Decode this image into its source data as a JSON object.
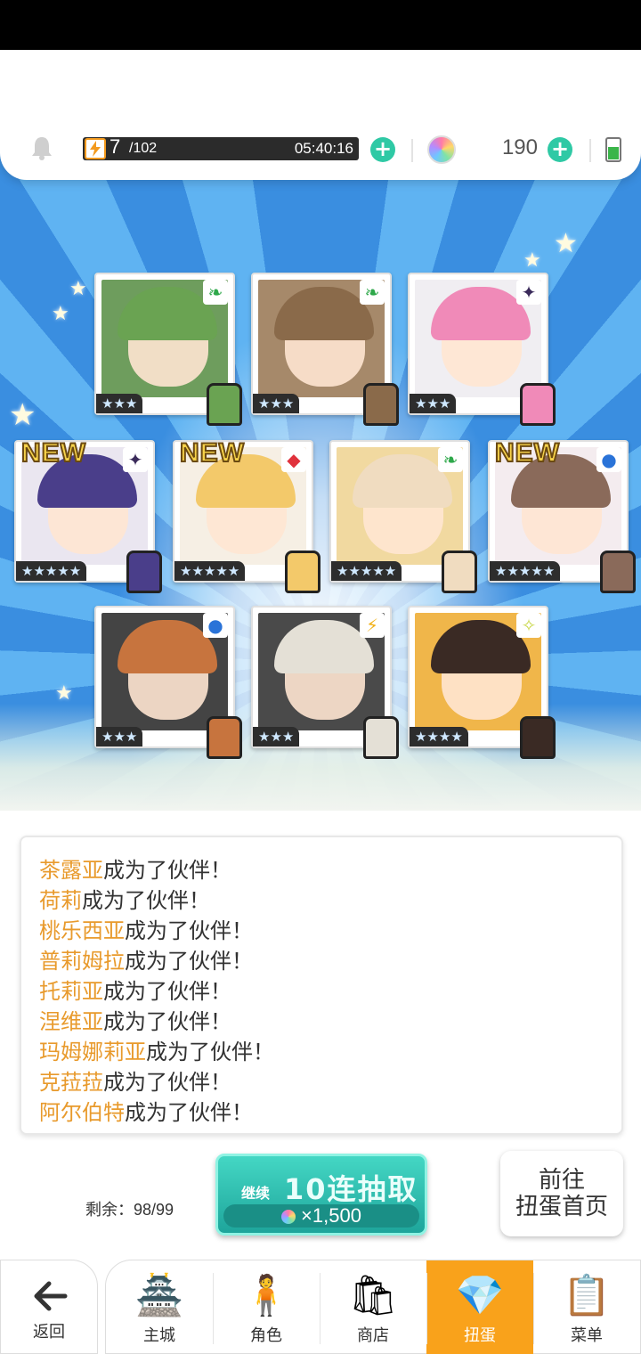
{
  "hud": {
    "stamina_current": "7",
    "stamina_max": "/102",
    "stamina_timer": "05:40:16",
    "gems": "190",
    "icons": [
      "bell-icon",
      "lightning-icon",
      "plus-icon",
      "gem-icon",
      "battery-icon"
    ]
  },
  "cards": [
    {
      "rarity": "★★★",
      "element": "leaf",
      "is_new": false,
      "hair": "#6aa352",
      "art_bg": "#6e9d5d"
    },
    {
      "rarity": "★★★",
      "element": "leaf",
      "is_new": false,
      "hair": "#8a6a4a",
      "art_bg": "#a6896a"
    },
    {
      "rarity": "★★★",
      "element": "dark",
      "is_new": false,
      "hair": "#f08ab8",
      "art_bg": "#f0eef2"
    },
    {
      "rarity": "★★★★★",
      "element": "dark",
      "is_new": true,
      "hair": "#4a3e8a",
      "art_bg": "#eae6f0"
    },
    {
      "rarity": "★★★★★",
      "element": "fire",
      "is_new": true,
      "hair": "#f3c96a",
      "art_bg": "#f6efe4"
    },
    {
      "rarity": "★★★★★",
      "element": "leaf",
      "is_new": false,
      "hair": "#f0dcc0",
      "art_bg": "#f1d9a0"
    },
    {
      "rarity": "★★★★★",
      "element": "water",
      "is_new": true,
      "hair": "#8a6a5a",
      "art_bg": "#f4ecef"
    },
    {
      "rarity": "★★★",
      "element": "water",
      "is_new": false,
      "hair": "#c7743e",
      "art_bg": "#444444"
    },
    {
      "rarity": "★★★",
      "element": "thunder",
      "is_new": false,
      "hair": "#e4e0d6",
      "art_bg": "#4a4a4a"
    },
    {
      "rarity": "★★★★",
      "element": "light",
      "is_new": false,
      "hair": "#3a2a24",
      "art_bg": "#f0b64a"
    }
  ],
  "new_label": "NEW",
  "log": [
    {
      "name": "茶露亚",
      "text": "成为了伙伴！"
    },
    {
      "name": "荷莉",
      "text": "成为了伙伴！"
    },
    {
      "name": "桃乐西亚",
      "text": "成为了伙伴！"
    },
    {
      "name": "普莉姆拉",
      "text": "成为了伙伴！"
    },
    {
      "name": "托莉亚",
      "text": "成为了伙伴！"
    },
    {
      "name": "涅维亚",
      "text": "成为了伙伴！"
    },
    {
      "name": "玛姆娜莉亚",
      "text": "成为了伙伴！"
    },
    {
      "name": "克菈菈",
      "text": "成为了伙伴！"
    },
    {
      "name": "阿尔伯特",
      "text": "成为了伙伴！"
    }
  ],
  "action": {
    "remaining": "剩余：98/99",
    "pull_continue": "继续",
    "pull_title": "10连抽取",
    "pull_cost": "×1,500",
    "home_line1": "前往",
    "home_line2": "扭蛋首页"
  },
  "nav": {
    "back": "返回",
    "items": [
      {
        "label": "主城",
        "icon": "castle-icon",
        "glyph": "🏯",
        "active": false
      },
      {
        "label": "角色",
        "icon": "character-icon",
        "glyph": "🧍",
        "active": false
      },
      {
        "label": "商店",
        "icon": "shop-icon",
        "glyph": "🛍",
        "active": false
      },
      {
        "label": "扭蛋",
        "icon": "gacha-icon",
        "glyph": "💎",
        "active": true
      },
      {
        "label": "菜单",
        "icon": "menu-icon",
        "glyph": "📋",
        "active": false
      }
    ]
  }
}
